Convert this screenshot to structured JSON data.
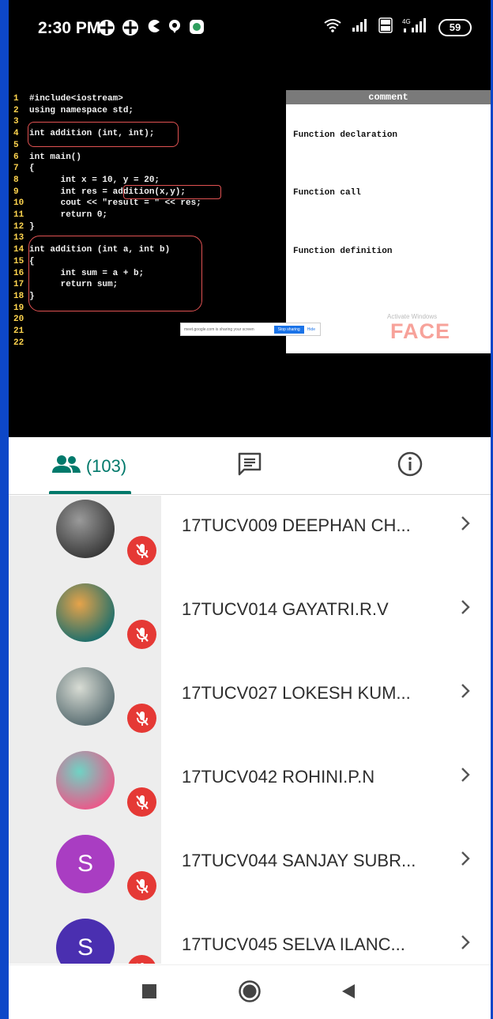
{
  "status_bar": {
    "time": "2:30 PM",
    "battery": "59",
    "icons": [
      "grid-app-icon",
      "grid-app-icon",
      "pacman-icon",
      "pin-icon",
      "message-icon",
      "wifi-icon",
      "signal-icon",
      "volte-icon",
      "4g-signal-icon",
      "battery-icon"
    ]
  },
  "shared_screen": {
    "code_lines": [
      {
        "n": "1",
        "text": "#include<iostream>"
      },
      {
        "n": "2",
        "text": "using namespace std;"
      },
      {
        "n": "3",
        "text": ""
      },
      {
        "n": "4",
        "text": "int addition (int, int);"
      },
      {
        "n": "5",
        "text": ""
      },
      {
        "n": "6",
        "text": "int main()"
      },
      {
        "n": "7",
        "text": "{"
      },
      {
        "n": "8",
        "text": "      int x = 10, y = 20;"
      },
      {
        "n": "9",
        "text": "      int res = addition(x,y);"
      },
      {
        "n": "10",
        "text": "      cout << \"result = \" << res;"
      },
      {
        "n": "11",
        "text": "      return 0;"
      },
      {
        "n": "12",
        "text": "}"
      },
      {
        "n": "13",
        "text": ""
      },
      {
        "n": "14",
        "text": "int addition (int a, int b)"
      },
      {
        "n": "15",
        "text": "{"
      },
      {
        "n": "16",
        "text": "      int sum = a + b;"
      },
      {
        "n": "17",
        "text": "      return sum;"
      },
      {
        "n": "18",
        "text": "}"
      },
      {
        "n": "19",
        "text": ""
      },
      {
        "n": "20",
        "text": ""
      },
      {
        "n": "21",
        "text": ""
      },
      {
        "n": "22",
        "text": ""
      }
    ],
    "comment_header": "comment",
    "comments": [
      "Function declaration",
      "Function call",
      "Function definition"
    ],
    "watermark": "Activate Windows",
    "logo": "FACE",
    "share_bar": {
      "text": "meet.google.com is sharing your screen",
      "stop_label": "Stop sharing",
      "hide_label": "Hide"
    }
  },
  "tabs": {
    "people_count": "(103)",
    "people_icon": "people-icon",
    "chat_icon": "chat-icon",
    "info_icon": "info-icon",
    "accent": "#00796b"
  },
  "participants": [
    {
      "name": "17TUCV009 DEEPHAN CH...",
      "avatar": "photo",
      "colors": [
        "#3a3a3a",
        "#9a9a9a"
      ]
    },
    {
      "name": "17TUCV014 GAYATRI.R.V",
      "avatar": "photo",
      "colors": [
        "#1f6f6b",
        "#e6a34a"
      ]
    },
    {
      "name": "17TUCV027 LOKESH KUM...",
      "avatar": "photo",
      "colors": [
        "#5b6f73",
        "#d8dcd4"
      ]
    },
    {
      "name": "17TUCV042 ROHINI.P.N",
      "avatar": "photo",
      "colors": [
        "#e95a8a",
        "#6fd3c4"
      ]
    },
    {
      "name": "17TUCV044 SANJAY SUBR...",
      "avatar": "S",
      "colors": [
        "#a93dc2",
        "#a93dc2"
      ]
    },
    {
      "name": "17TUCV045 SELVA ILANC...",
      "avatar": "S",
      "colors": [
        "#4a2fb0",
        "#4a2fb0"
      ]
    }
  ],
  "mute_color": "#e53935",
  "nav": [
    "recents-icon",
    "home-icon",
    "back-icon"
  ]
}
